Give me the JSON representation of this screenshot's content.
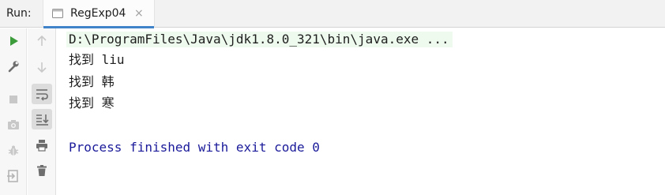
{
  "header": {
    "run_label": "Run:",
    "tab_label": "RegExp04",
    "tab_close": "×"
  },
  "icons": {
    "left_toolbar": [
      "run-icon",
      "wrench-icon",
      "stop-icon",
      "camera-icon",
      "debug-bug-icon",
      "exit-icon"
    ],
    "right_toolbar": [
      "arrow-up-icon",
      "arrow-down-icon",
      "soft-wrap-icon",
      "scroll-to-end-icon",
      "print-icon",
      "trash-icon"
    ]
  },
  "console": {
    "command": "D:\\ProgramFiles\\Java\\jdk1.8.0_321\\bin\\java.exe ...",
    "outputs": [
      "找到 liu",
      "找到 韩",
      "找到 寒"
    ],
    "exit_message": "Process finished with exit code 0"
  },
  "colors": {
    "run_green": "#3c9c3c",
    "accent_blue": "#4083c9",
    "command_highlight": "#edfaed",
    "exit_text": "#1a1a9a",
    "icon_gray": "#6e6e6e"
  }
}
